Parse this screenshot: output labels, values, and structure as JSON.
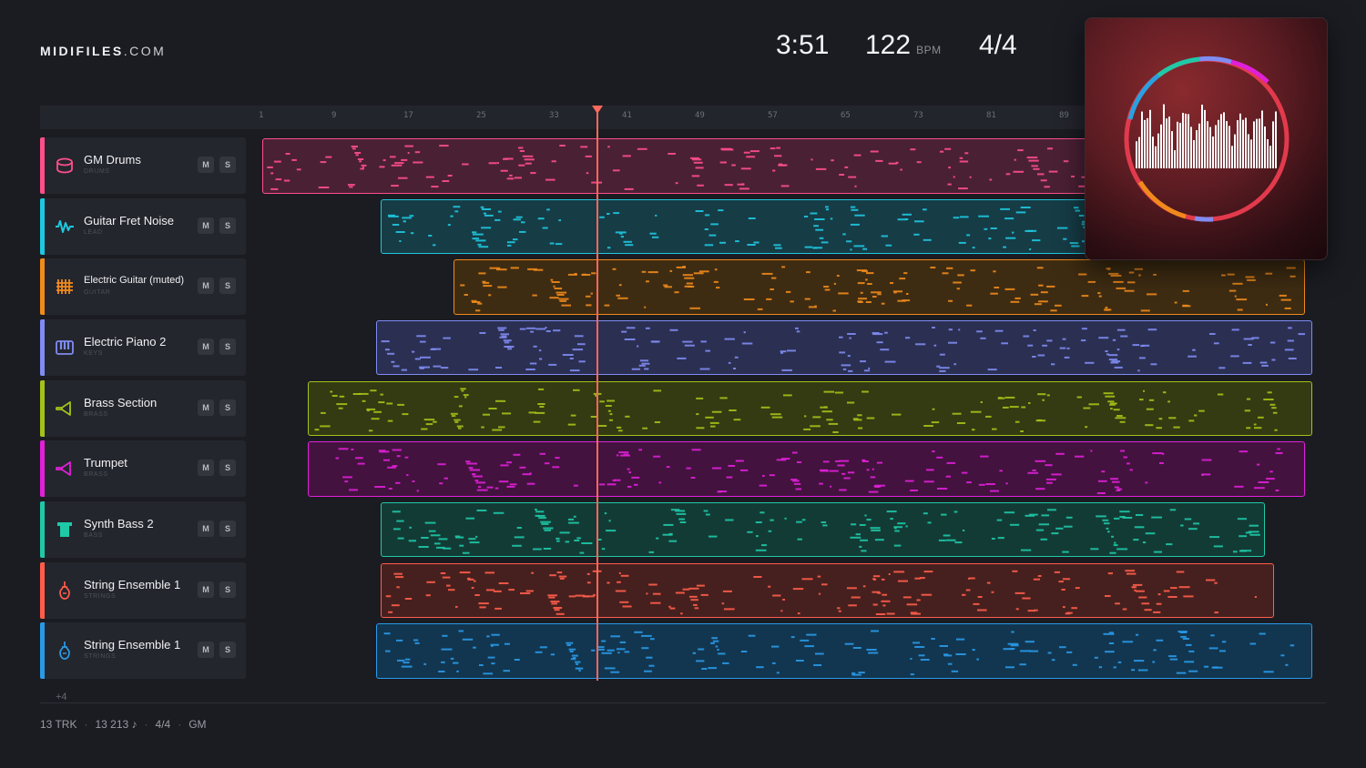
{
  "app": {
    "logo_bold": "MIDIFILES",
    "logo_rest": ".COM"
  },
  "header": {
    "duration": "3:51",
    "tempo": "122",
    "tempo_unit": "BPM",
    "time_signature": "4/4"
  },
  "ruler": {
    "ticks": [
      "1",
      "9",
      "17",
      "25",
      "33",
      "41",
      "49",
      "57",
      "65",
      "73",
      "81",
      "89"
    ]
  },
  "tracks": [
    {
      "name": "GM Drums",
      "category": "DRUMS",
      "color": "#ff4f8b",
      "icon": "drum-icon"
    },
    {
      "name": "Guitar Fret Noise",
      "category": "LEAD",
      "color": "#1ec8e0",
      "icon": "waveform-icon"
    },
    {
      "name": "Electric Guitar (muted)",
      "category": "GUITAR",
      "color": "#f08a1c",
      "icon": "guitar-grid-icon"
    },
    {
      "name": "Electric Piano 2",
      "category": "KEYS",
      "color": "#7f8cf2",
      "icon": "piano-keys-icon"
    },
    {
      "name": "Brass Section",
      "category": "BRASS",
      "color": "#a3c21a",
      "icon": "horn-icon"
    },
    {
      "name": "Trumpet",
      "category": "BRASS",
      "color": "#e020d8",
      "icon": "trumpet-icon"
    },
    {
      "name": "Synth Bass 2",
      "category": "BASS",
      "color": "#1fc9a8",
      "icon": "bass-bar-icon"
    },
    {
      "name": "String Ensemble 1",
      "category": "STRINGS",
      "color": "#ff5d4a",
      "icon": "violin-icon"
    },
    {
      "name": "String Ensemble 1",
      "category": "STRINGS",
      "color": "#2a9ae8",
      "icon": "violin-icon"
    }
  ],
  "buttons": {
    "mute": "M",
    "solo": "S"
  },
  "more_tracks": "+4",
  "footer": {
    "tracks": "13 TRK",
    "notes": "13 213 ♪",
    "meter": "4/4",
    "standard": "GM"
  }
}
